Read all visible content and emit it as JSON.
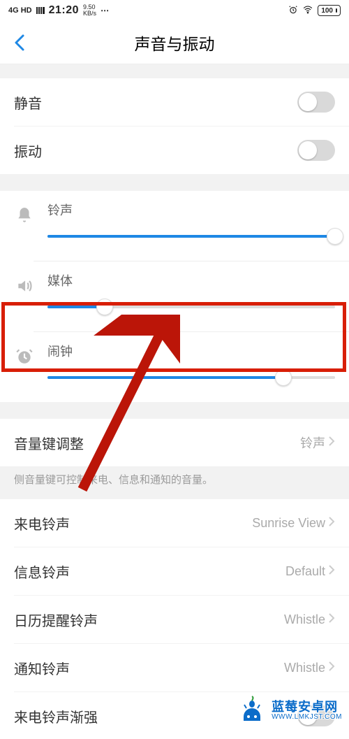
{
  "status": {
    "network": "4G HD",
    "time": "21:20",
    "speed_value": "9.50",
    "speed_unit": "KB/s",
    "battery": "100"
  },
  "header": {
    "title": "声音与振动"
  },
  "toggles": {
    "mute_label": "静音",
    "mute_on": false,
    "vibrate_label": "振动",
    "vibrate_on": false
  },
  "volumes": {
    "ringtone": {
      "label": "铃声",
      "percent": 100
    },
    "media": {
      "label": "媒体",
      "percent": 20
    },
    "alarm": {
      "label": "闹钟",
      "percent": 82
    }
  },
  "volume_key": {
    "label": "音量键调整",
    "value": "铃声",
    "description": "侧音量键可控制来电、信息和通知的音量。"
  },
  "ringtones": {
    "incoming": {
      "label": "来电铃声",
      "value": "Sunrise View"
    },
    "message": {
      "label": "信息铃声",
      "value": "Default"
    },
    "calendar": {
      "label": "日历提醒铃声",
      "value": "Whistle"
    },
    "notify": {
      "label": "通知铃声",
      "value": "Whistle"
    },
    "ascending": {
      "label": "来电铃声渐强",
      "on": false
    }
  },
  "watermark": {
    "cn": "蓝莓安卓网",
    "en": "WWW.LMKJST.COM"
  }
}
